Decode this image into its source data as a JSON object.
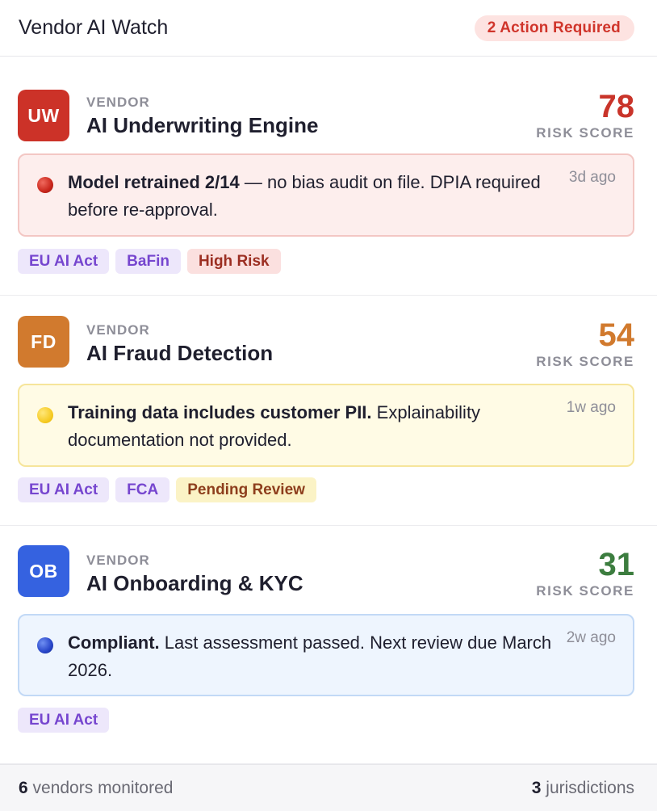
{
  "header": {
    "title": "Vendor AI Watch",
    "badge": "2 Action Required",
    "badge_color": "#d0352b"
  },
  "vendors": [
    {
      "initials": "UW",
      "avatar_color": "#cc3228",
      "kicker": "VENDOR",
      "name": "AI Underwriting Engine",
      "score": "78",
      "score_color": "#c9342a",
      "score_label": "RISK SCORE",
      "alert": {
        "status": "red",
        "dot_icon": "red-circle-icon",
        "bold": "Model retrained 2/14",
        "text": " — no bias audit on file. DPIA required before re-approval.",
        "time": "3d ago"
      },
      "tags": [
        "EU AI Act",
        "BaFin",
        "High Risk"
      ]
    },
    {
      "initials": "FD",
      "avatar_color": "#d17a2e",
      "kicker": "VENDOR",
      "name": "AI Fraud Detection",
      "score": "54",
      "score_color": "#d17a2e",
      "score_label": "RISK SCORE",
      "alert": {
        "status": "yellow",
        "dot_icon": "yellow-circle-icon",
        "bold": "Training data includes customer PII.",
        "text": " Explainability documentation not provided.",
        "time": "1w ago"
      },
      "tags": [
        "EU AI Act",
        "FCA",
        "Pending Review"
      ]
    },
    {
      "initials": "OB",
      "avatar_color": "#3562e0",
      "kicker": "VENDOR",
      "name": "AI Onboarding & KYC",
      "score": "31",
      "score_color": "#3c7d3f",
      "score_label": "RISK SCORE",
      "alert": {
        "status": "blue",
        "dot_icon": "blue-circle-icon",
        "bold": "Compliant.",
        "text": " Last assessment passed. Next review due March 2026.",
        "time": "2w ago"
      },
      "tags": [
        "EU AI Act"
      ]
    }
  ],
  "footer": {
    "vendors_count": "6",
    "vendors_label": " vendors monitored",
    "jurisdictions_count": "3",
    "jurisdictions_label": " jurisdictions"
  }
}
